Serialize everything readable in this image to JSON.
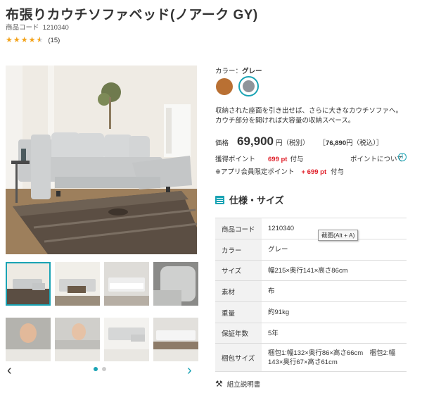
{
  "product": {
    "title": "布張りカウチソファベッド(ノアーク GY)",
    "code_label": "商品コード",
    "code_value": "1210340",
    "review_count": "(15)",
    "rating": 4.5
  },
  "gallery": {
    "prev_label": "‹",
    "next_label": "›",
    "active_index": 0,
    "page_count": 2
  },
  "color": {
    "label": "カラー：",
    "selected": "グレー",
    "swatches": [
      {
        "name": "brown",
        "hex": "#b97033"
      },
      {
        "name": "gray",
        "hex": "#8f949a"
      }
    ]
  },
  "description": "収納された座面を引き出せば、さらに大きなカウチソファへ。カウチ部分を開ければ大容量の収納スペース。",
  "price": {
    "label": "価格",
    "amount": "69,900",
    "unit_tax": "円（税別）",
    "bracket_open": "［",
    "taxinc_amount": "76,890",
    "taxinc_unit": "円（税込）",
    "bracket_close": "］"
  },
  "points": {
    "label": "獲得ポイント",
    "value": "699 pt",
    "suffix": "付与",
    "link": "ポイントについて",
    "app_label": "※アプリ会員限定ポイント",
    "app_value": "+ 699 pt",
    "app_suffix": "付与"
  },
  "spec": {
    "title": "仕様・サイズ",
    "rows": [
      {
        "key": "商品コード",
        "value": "1210340"
      },
      {
        "key": "カラー",
        "value": "グレー"
      },
      {
        "key": "サイズ",
        "value": "幅215×奥行141×高さ86cm"
      },
      {
        "key": "素材",
        "value": "布"
      },
      {
        "key": "重量",
        "value": "約91kg"
      },
      {
        "key": "保証年数",
        "value": "5年"
      },
      {
        "key": "梱包サイズ",
        "value": "梱包1:幅132×奥行86×高さ66cm　梱包2:幅143×奥行67×高さ61cm"
      }
    ]
  },
  "tooltip": "截图(Alt + A)",
  "manual_label": "組立説明書",
  "colors": {
    "accent": "#1aa3b4",
    "point_red": "#e0202a",
    "star": "#f3a31b"
  }
}
